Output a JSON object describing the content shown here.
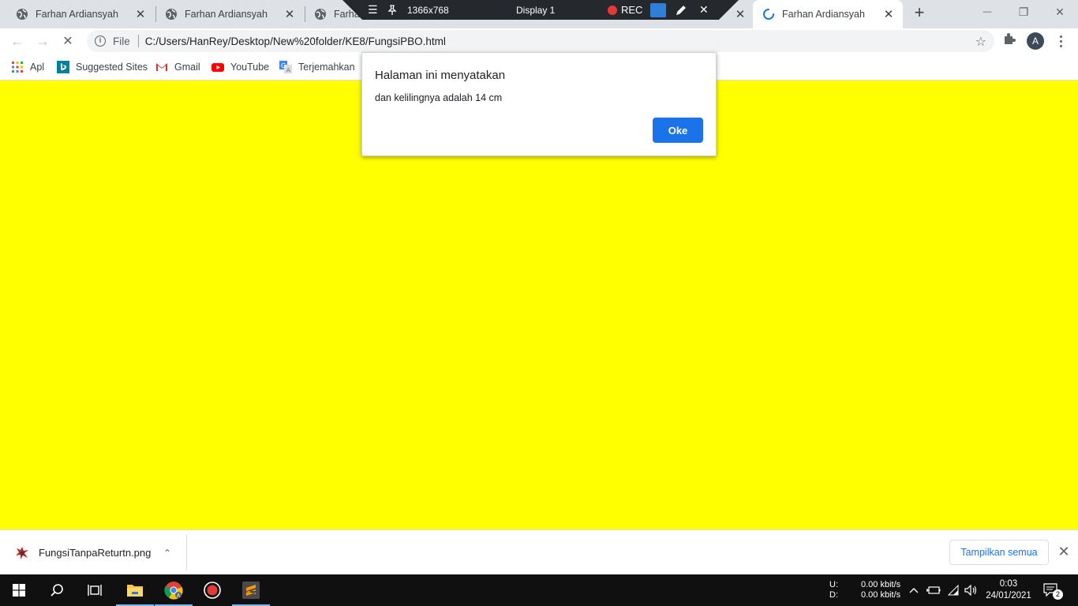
{
  "tabs": [
    {
      "title": "Farhan Ardiansyah",
      "close": "✕"
    },
    {
      "title": "Farhan Ardiansyah",
      "close": "✕"
    },
    {
      "title": "Farha",
      "close": ""
    },
    {
      "title": "Farhan Ardiansyah",
      "close": "✕",
      "active": true
    }
  ],
  "new_tab": "+",
  "window_controls": {
    "minimize": "—",
    "restore": "❐",
    "close": "✕"
  },
  "recorder": {
    "menu": "☰",
    "resolution": "1366x768",
    "display": "Display 1",
    "rec": "REC",
    "rec_color": "#e53935",
    "close": "✕"
  },
  "toolbar": {
    "back": "←",
    "forward": "→",
    "reload": "✕",
    "scheme": "File",
    "url": "C:/Users/HanRey/Desktop/New%20folder/KE8/FungsiPBO.html",
    "star": "☆",
    "profile_initial": "A"
  },
  "bookmarks": [
    {
      "label": "Apl",
      "icon": "apps-grid-icon"
    },
    {
      "label": "Suggested Sites",
      "icon": "bing-icon"
    },
    {
      "label": "Gmail",
      "icon": "gmail-icon"
    },
    {
      "label": "YouTube",
      "icon": "youtube-icon"
    },
    {
      "label": "Terjemahkan",
      "icon": "translate-icon"
    }
  ],
  "page": {
    "background": "#ffff00"
  },
  "dialog": {
    "title": "Halaman ini menyatakan",
    "message": "dan kelilingnya adalah 14 cm",
    "ok_label": "Oke",
    "accent": "#1a73e8"
  },
  "download_shelf": {
    "file_name": "FungsiTanpaReturtn.png",
    "chevron": "⌃",
    "show_all_label": "Tampilkan semua",
    "close": "✕"
  },
  "taskbar": {
    "net_up_label": "U:",
    "net_down_label": "D:",
    "net_up_value": "0.00 kbit/s",
    "net_down_value": "0.00 kbit/s",
    "time": "0:03",
    "date": "24/01/2021",
    "notifications": "2"
  }
}
